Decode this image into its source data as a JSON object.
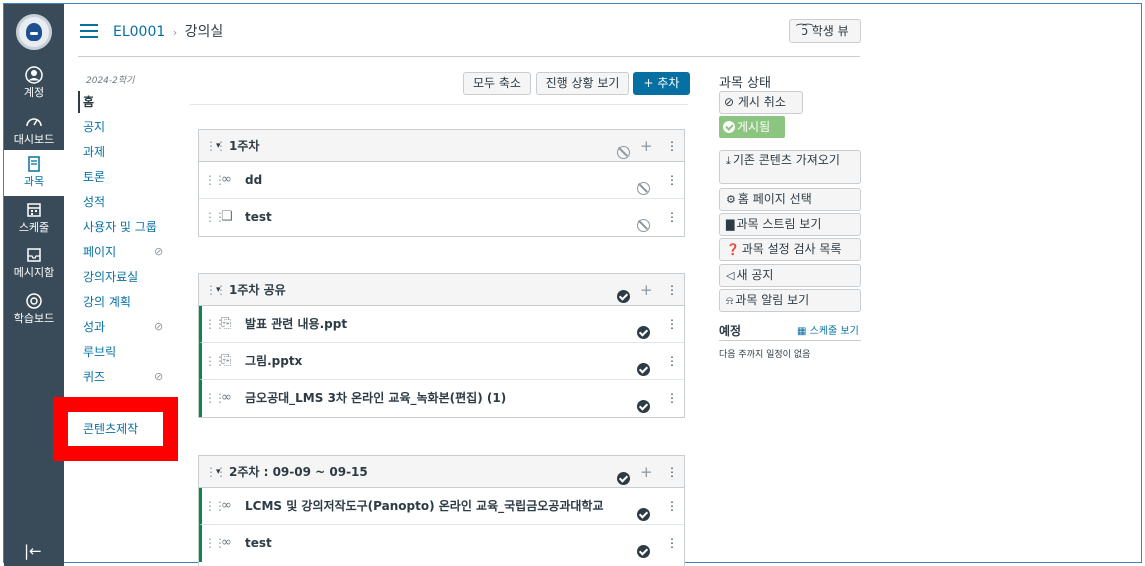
{
  "global_nav": {
    "items": [
      {
        "label": "계정",
        "icon": "user-icon"
      },
      {
        "label": "대시보드",
        "icon": "dashboard-icon"
      },
      {
        "label": "과목",
        "icon": "book-icon"
      },
      {
        "label": "스케줄",
        "icon": "calendar-icon"
      },
      {
        "label": "메시지함",
        "icon": "inbox-icon"
      },
      {
        "label": "학습보드",
        "icon": "help-icon"
      }
    ],
    "active_index": 2,
    "collapse_glyph": "|←"
  },
  "header": {
    "course_code": "EL0001",
    "separator": "›",
    "page": "강의실",
    "student_view_label": "학생 뷰"
  },
  "course_nav": {
    "term": "2024-2학기",
    "items": [
      {
        "label": "홈",
        "active": true,
        "hidden": false
      },
      {
        "label": "공지",
        "hidden": false
      },
      {
        "label": "과제",
        "hidden": false
      },
      {
        "label": "토론",
        "hidden": false
      },
      {
        "label": "성적",
        "hidden": false
      },
      {
        "label": "사용자 및 그룹",
        "hidden": false
      },
      {
        "label": "페이지",
        "hidden": true
      },
      {
        "label": "강의자료실",
        "hidden": false
      },
      {
        "label": "강의 계획",
        "hidden": false
      },
      {
        "label": "성과",
        "hidden": true
      },
      {
        "label": "루브릭",
        "hidden": false
      },
      {
        "label": "퀴즈",
        "hidden": true
      }
    ],
    "highlighted_item": "콘텐츠제작"
  },
  "toolbar": {
    "collapse_all": "모두 축소",
    "view_progress": "진행 상황 보기",
    "add_module": "+ 추차"
  },
  "modules": [
    {
      "title": "1주차",
      "published": false,
      "items": [
        {
          "name": "dd",
          "type_icon": "link-icon",
          "published": false
        },
        {
          "name": "test",
          "type_icon": "discussion-icon",
          "published": false
        }
      ]
    },
    {
      "title": "1주차 공유",
      "published": true,
      "items": [
        {
          "name": "발표 관련 내용.ppt",
          "type_icon": "attachment-icon",
          "published": true
        },
        {
          "name": "그림.pptx",
          "type_icon": "attachment-icon",
          "published": true
        },
        {
          "name": "금오공대_LMS 3차 온라인 교육_녹화본(편집) (1)",
          "type_icon": "link-icon",
          "published": true
        }
      ]
    },
    {
      "title": "2주차 : 09-09 ~ 09-15",
      "published": true,
      "items": [
        {
          "name": "LCMS 및 강의저작도구(Panopto) 온라인 교육_국립금오공과대학교",
          "type_icon": "link-icon",
          "published": true
        },
        {
          "name": "test",
          "type_icon": "link-icon",
          "published": true
        }
      ]
    }
  ],
  "sidebar": {
    "status_title": "과목 상태",
    "unpublish": "게시 취소",
    "published": "게시됨",
    "buttons": [
      "기존 콘텐츠 가져오기",
      "홈 페이지 선택",
      "과목 스트림 보기",
      "과목 설정 검사 목록",
      "새 공지",
      "과목 알림 보기"
    ],
    "todo_title": "예정",
    "todo_link": "스케줄 보기",
    "todo_empty": "다음 주까지 일정이 없음"
  },
  "colors": {
    "nav_bg": "#394b58",
    "link": "#0770a3",
    "published_green": "#0b874b",
    "published_badge": "#8cc57f",
    "highlight_red": "#ff0000"
  }
}
